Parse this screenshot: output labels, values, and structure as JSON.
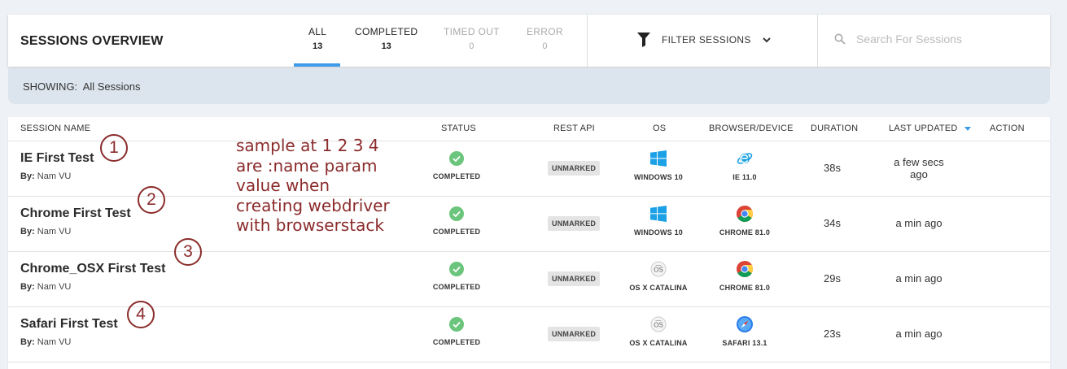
{
  "header": {
    "title": "SESSIONS OVERVIEW",
    "tabs": [
      {
        "label": "ALL",
        "count": "13"
      },
      {
        "label": "COMPLETED",
        "count": "13"
      },
      {
        "label": "TIMED OUT",
        "count": "0"
      },
      {
        "label": "ERROR",
        "count": "0"
      }
    ],
    "filter_label": "FILTER SESSIONS",
    "search_placeholder": "Search For Sessions",
    "accent_color": "#3d9be9"
  },
  "showing": {
    "label": "SHOWING:",
    "value": "All Sessions"
  },
  "table": {
    "columns": [
      "SESSION NAME",
      "STATUS",
      "REST API",
      "OS",
      "BROWSER/DEVICE",
      "DURATION",
      "LAST UPDATED",
      "ACTION"
    ],
    "rows": [
      {
        "name": "IE First Test",
        "by_label": "By:",
        "by": "Nam VU",
        "status": "COMPLETED",
        "rest_api": "UNMARKED",
        "os": "WINDOWS 10",
        "os_icon": "windows-icon",
        "browser": "IE 11.0",
        "browser_icon": "ie-icon",
        "duration": "38s",
        "updated_1": "a few secs",
        "updated_2": "ago"
      },
      {
        "name": "Chrome First Test",
        "by_label": "By:",
        "by": "Nam VU",
        "status": "COMPLETED",
        "rest_api": "UNMARKED",
        "os": "WINDOWS 10",
        "os_icon": "windows-icon",
        "browser": "CHROME 81.0",
        "browser_icon": "chrome-icon",
        "duration": "34s",
        "updated_1": "a min ago",
        "updated_2": ""
      },
      {
        "name": "Chrome_OSX First Test",
        "by_label": "By:",
        "by": "Nam VU",
        "status": "COMPLETED",
        "rest_api": "UNMARKED",
        "os": "OS X CATALINA",
        "os_icon": "osx-icon",
        "browser": "CHROME 81.0",
        "browser_icon": "chrome-icon",
        "duration": "29s",
        "updated_1": "a min ago",
        "updated_2": ""
      },
      {
        "name": "Safari First Test",
        "by_label": "By:",
        "by": "Nam VU",
        "status": "COMPLETED",
        "rest_api": "UNMARKED",
        "os": "OS X CATALINA",
        "os_icon": "osx-icon",
        "browser": "SAFARI 13.1",
        "browser_icon": "safari-icon",
        "duration": "23s",
        "updated_1": "a min ago",
        "updated_2": ""
      }
    ]
  },
  "annotations": {
    "numbers": [
      "1",
      "2",
      "3",
      "4"
    ],
    "note_lines": [
      "sample at 1 2 3 4",
      "are :name param",
      "value when",
      "creating webdriver",
      "with browserstack"
    ],
    "color": "#8b2b2b"
  }
}
